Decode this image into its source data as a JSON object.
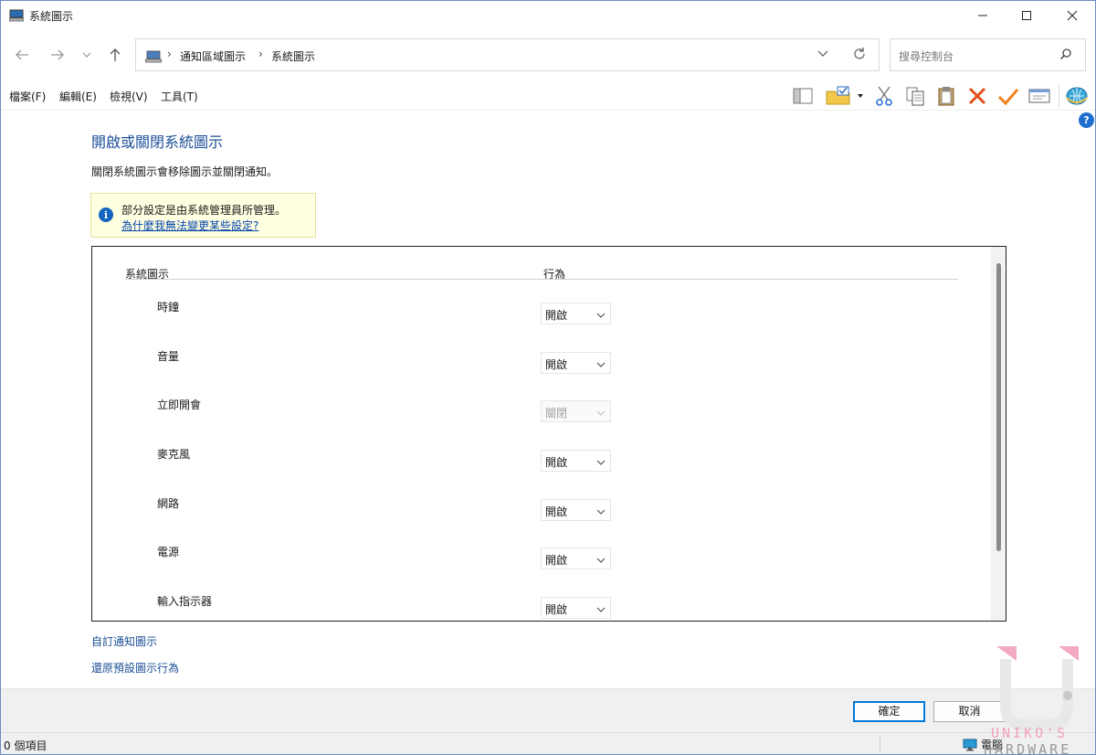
{
  "window": {
    "title": "系統圖示"
  },
  "address": {
    "crumbs": [
      "通知區域圖示",
      "系統圖示"
    ]
  },
  "search": {
    "placeholder": "搜尋控制台"
  },
  "menu": [
    "檔案(F)",
    "編輯(E)",
    "檢視(V)",
    "工具(T)"
  ],
  "content": {
    "title": "開啟或關閉系統圖示",
    "description": "關閉系統圖示會移除圖示並關閉通知。",
    "info": {
      "message": "部分設定是由系統管理員所管理。",
      "link": "為什麼我無法變更某些設定?"
    },
    "table": {
      "col_icon": "系統圖示",
      "col_behavior": "行為",
      "rows": [
        {
          "label": "時鐘",
          "value": "開啟",
          "disabled": false
        },
        {
          "label": "音量",
          "value": "開啟",
          "disabled": false
        },
        {
          "label": "立即開會",
          "value": "關閉",
          "disabled": true
        },
        {
          "label": "麥克風",
          "value": "開啟",
          "disabled": false
        },
        {
          "label": "網路",
          "value": "開啟",
          "disabled": false
        },
        {
          "label": "電源",
          "value": "開啟",
          "disabled": false
        },
        {
          "label": "輸入指示器",
          "value": "開啟",
          "disabled": false
        }
      ]
    },
    "links": {
      "customize": "自訂通知圖示",
      "restore": "還原預設圖示行為"
    }
  },
  "buttons": {
    "ok": "確定",
    "cancel": "取消"
  },
  "status": {
    "count": "0 個項目",
    "location": "電腦"
  },
  "watermark": {
    "line1": "UNIKO'S",
    "line2": "HARDWARE"
  },
  "colors": {
    "link": "#1c4f97",
    "info_bg": "#ffffe1",
    "accent": "#0078d7"
  }
}
